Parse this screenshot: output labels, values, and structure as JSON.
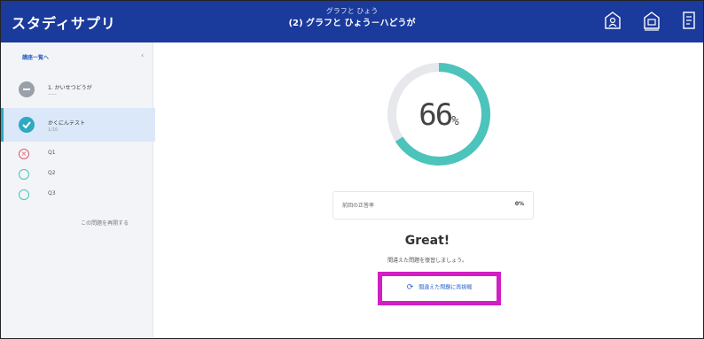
{
  "header": {
    "logo": "スタディサプリ",
    "subtitle": "グラフと ひょう",
    "title": "(2) グラフと ひょう－ハどうが",
    "icons": [
      "home-person-icon",
      "home-school-icon",
      "document-icon"
    ]
  },
  "sidebar": {
    "back_label": "講座一覧へ",
    "lessons": [
      {
        "title": "1. かいせつどうが",
        "sub": "——",
        "state": "gray"
      },
      {
        "title": "かくにんテスト",
        "sub": "1/10",
        "state": "done"
      }
    ],
    "questions": [
      {
        "mark": "wrong",
        "label": "Q1"
      },
      {
        "mark": "right",
        "label": "Q2"
      },
      {
        "mark": "right",
        "label": "Q3"
      }
    ],
    "restart_label": "この問題を再開する"
  },
  "result": {
    "score": "66",
    "score_unit": "%",
    "score_fraction": 0.66,
    "card_label": "前回の正答率",
    "card_value": "0%",
    "great": "Great!",
    "message": "間違えた問題を復習しましょう。",
    "review_button": "間違えた問題に再挑戦"
  },
  "colors": {
    "header_bg": "#1a3a9c",
    "ring": "#4cc3bb",
    "ring_track": "#e6e8eb",
    "highlight": "#d21fc3",
    "link": "#2b63c6"
  }
}
